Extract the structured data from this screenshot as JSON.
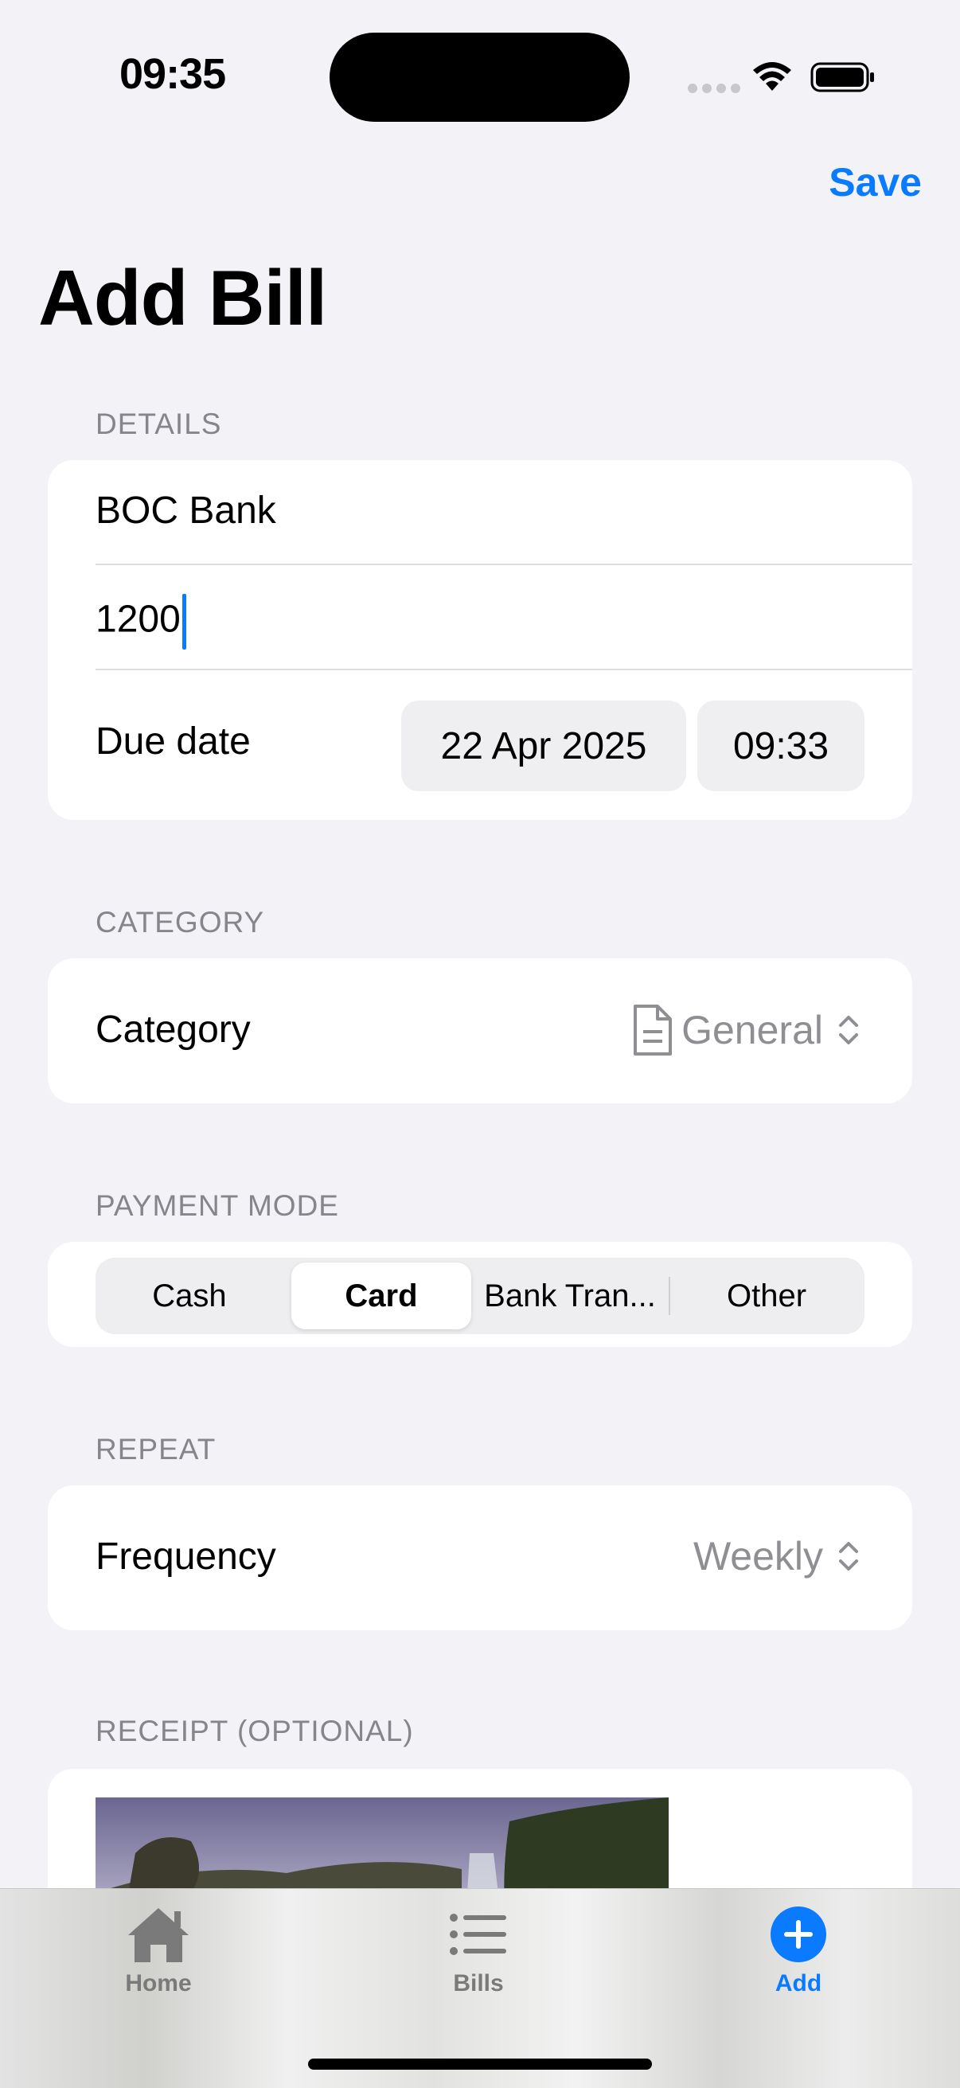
{
  "status_bar": {
    "time": "09:35"
  },
  "nav": {
    "save_label": "Save",
    "title": "Add Bill"
  },
  "details": {
    "header": "DETAILS",
    "name_value": "BOC Bank",
    "amount_value": "1200",
    "due_date_label": "Due date",
    "due_date": "22 Apr 2025",
    "due_time": "09:33"
  },
  "category": {
    "header": "CATEGORY",
    "label": "Category",
    "value": "General",
    "icon": "doc-icon"
  },
  "payment_mode": {
    "header": "PAYMENT MODE",
    "options": [
      "Cash",
      "Card",
      "Bank Tran...",
      "Other"
    ],
    "selected": "Card"
  },
  "repeat": {
    "header": "REPEAT",
    "label": "Frequency",
    "value": "Weekly"
  },
  "receipt": {
    "header": "RECEIPT (OPTIONAL)"
  },
  "tabbar": {
    "tabs": [
      {
        "label": "Home",
        "icon": "house-icon"
      },
      {
        "label": "Bills",
        "icon": "list-icon"
      },
      {
        "label": "Add",
        "icon": "plus-circle-icon"
      }
    ],
    "active": "Add"
  },
  "colors": {
    "accent": "#0a7aff",
    "secondary_text": "#8e8e93",
    "background": "#f2f2f7"
  }
}
